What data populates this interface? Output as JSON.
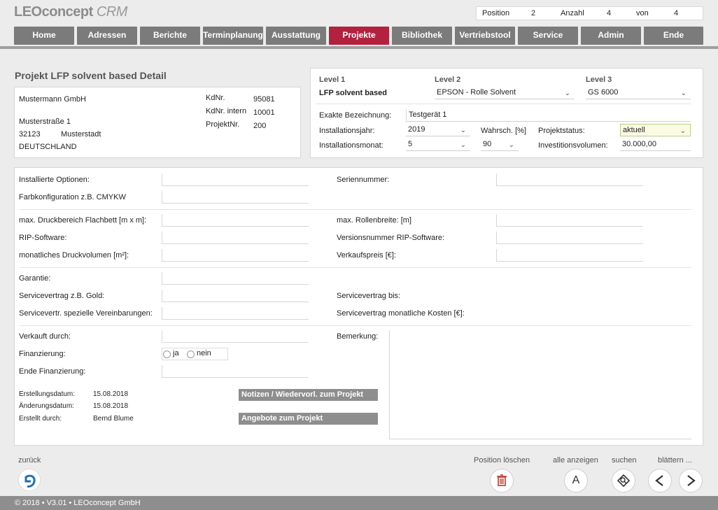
{
  "app": {
    "logo_main": "LEOconcept",
    "logo_sub": " CRM"
  },
  "position_bar": {
    "position_label": "Position",
    "position_value": "2",
    "count_label": "Anzahl",
    "count_value": "4",
    "of_label": "von",
    "of_value": "4"
  },
  "nav": {
    "items": [
      {
        "label": "Home"
      },
      {
        "label": "Adressen"
      },
      {
        "label": "Berichte"
      },
      {
        "label": "Terminplanung"
      },
      {
        "label": "Ausstattung"
      },
      {
        "label": "Projekte"
      },
      {
        "label": "Bibliothek"
      },
      {
        "label": "Vertriebstool"
      },
      {
        "label": "Service"
      },
      {
        "label": "Admin"
      },
      {
        "label": "Ende"
      }
    ],
    "active": "Projekte"
  },
  "page": {
    "title": "Projekt LFP solvent based Detail"
  },
  "address": {
    "company": "Mustermann GmbH",
    "street": "Musterstraße 1",
    "zip": "32123",
    "city": "Musterstadt",
    "country": "DEUTSCHLAND",
    "kdnr_label": "KdNr.",
    "kdnr_value": "95081",
    "kdnr_intern_label": "KdNr. intern",
    "kdnr_intern_value": "10001",
    "projektnr_label": "ProjektNr.",
    "projektnr_value": "200"
  },
  "levels": {
    "level1_label": "Level 1",
    "level1_value": "LFP solvent based",
    "level2_label": "Level 2",
    "level2_value": "EPSON - Rolle Solvent",
    "level3_label": "Level 3",
    "level3_value": "GS 6000",
    "bezeichnung_label": "Exakte Bezeichnung:",
    "bezeichnung_value": "Testgerät 1",
    "inst_jahr_label": "Installationsjahr:",
    "inst_jahr_value": "2019",
    "inst_monat_label": "Installationsmonat:",
    "inst_monat_value": "5",
    "wahrsch_label": "Wahrsch. [%]",
    "wahrsch_value": "90",
    "status_label": "Projektstatus:",
    "status_value": "aktuell",
    "invest_label": "Investitionsvolumen:",
    "invest_value": "30.000,00"
  },
  "form": {
    "optionen_label": "Installierte Optionen:",
    "seriennummer_label": "Seriennummer:",
    "farbkonfig_label": "Farbkonfiguration z.B. CMYKW",
    "druckbereich_label": "max. Druckbereich Flachbett [m x m]:",
    "rollenbreite_label": "max. Rollenbreite: [m]",
    "rip_label": "RIP-Software:",
    "rip_version_label": "Versionsnummer RIP-Software:",
    "druckvolumen_label": "monatliches Druckvolumen [m²]:",
    "verkaufspreis_label": "Verkaufspreis [€]:",
    "garantie_label": "Garantie:",
    "servicevertrag_label": "Servicevertrag z.B. Gold:",
    "servicevertrag_bis_label": "Servicevertrag bis:",
    "vereinbarungen_label": "Servicevertr. spezielle Vereinbarungen:",
    "sv_kosten_label": "Servicevertrag monatliche Kosten [€]:",
    "verkauft_label": "Verkauft durch:",
    "bemerkung_label": "Bemerkung:",
    "finanzierung_label": "Finanzierung:",
    "fin_ja": "ja",
    "fin_nein": "nein",
    "ende_fin_label": "Ende Finanzierung:"
  },
  "meta": {
    "erstellt_label": "Erstellungsdatum:",
    "erstellt_value": "15.08.2018",
    "geaendert_label": "Änderungsdatum:",
    "geaendert_value": "15.08.2018",
    "erstellt_durch_label": "Erstellt durch:",
    "erstellt_durch_value": "Bernd Blume",
    "notizen_button": "Notizen / Wiedervorl. zum Projekt",
    "angebote_button": "Angebote zum Projekt"
  },
  "footer": {
    "back_label": "zurück",
    "delete_label": "Position löschen",
    "show_all_label": "alle anzeigen",
    "show_all_glyph": "A",
    "search_label": "suchen",
    "browse_label": "blättern ...",
    "copyright": "© 2018 • V3.01 • LEOconcept GmbH"
  },
  "colors": {
    "accent": "#b3213f",
    "nav_bg": "#7b7b7b",
    "bar_gray": "#8e8e8e"
  },
  "icons": [
    "back-arrow-icon",
    "trash-icon",
    "search-tag-icon",
    "chevron-left-icon",
    "chevron-right-icon"
  ]
}
